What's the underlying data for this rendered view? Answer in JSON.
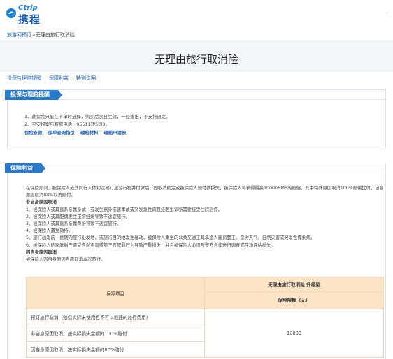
{
  "logo": {
    "en": "Ctrip",
    "cn": "携程"
  },
  "top_right": "·",
  "breadcrumb": {
    "link": "旅游网预订",
    "current": ">无理由旅行取消险"
  },
  "page_title": "无理由旅行取消险",
  "tabs": [
    "投保与理赔提醒",
    "保障利益",
    "特别说明"
  ],
  "section1": {
    "title": "投保与理赔提醒",
    "lines": [
      "1、此保险只能在下单时选择，购买后次日生效，一经售出，不支持退定。",
      "2、平安报案与客服电话：95511转5转8。"
    ],
    "links": [
      "保险条款",
      "保单查询指引",
      "理赔材料",
      "理赔申请表"
    ]
  },
  "section2": {
    "title": "保障利益",
    "intro": "在保险期间，被保险人或其同行人依约定预订旅游行程并付款后，如取消约定或被保险人预付款损失，被保险人将获得最高10000RMB的赔偿，其中特殊原因取消100%赔偿比付，自身原因取消80%取消赔付。",
    "non_self_heading": "非自身原因取消",
    "non_self_items": [
      "1、被保险人或其直系亲属身故，或发生意外伤害事故或突发急性病且经医生诊断需要接受住院治疗。",
      "2、被保险人或其配偶发生正常妊娠导致不适宜旅行。",
      "3、被保险人或其直系亲属骨折导致不适宜旅行。",
      "4、被保险人遭受劫持。",
      "5、旅行出发前一星期内旅行出发地、或旅行目的地发生暴动、被保险人乘坐的公共交通工具承运人雇员罢工、恶劣天气、自然灾害或突发性传染病。",
      "6、被保险人的家庭财产遭受自然灾害或第三方犯罪行为导致严重损失，并且被保险人必须与警方合作进行调查或在场评估损失。"
    ],
    "self_heading": "因自身原因取消",
    "self_text": "被保险人因自身原因自愿取消本次旅行。",
    "table": {
      "col1_header": "保障项目",
      "plan_name": "无理由旅行取消险 升级型",
      "amount_header": "保险限额（元）",
      "rows": [
        "预订旅行取消（赔偿实际未使用但不可以退还的旅行费用）",
        "非自身原因取消：按实际损失金额的100%赔付",
        "因自身原因取消：按实际损失金额的80%赔付"
      ],
      "amount": "10000"
    }
  },
  "colors": {
    "brand": "#1f5fb0",
    "tag": "#2a79c6",
    "table_header": "#fbe3c6"
  }
}
